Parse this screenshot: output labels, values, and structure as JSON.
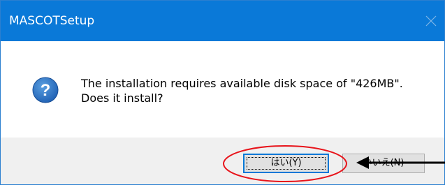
{
  "window": {
    "title": "MASCOTSetup",
    "close_icon": "close-icon"
  },
  "message": {
    "icon": "question-icon",
    "line1": "The installation requires available disk space of \"426MB\".",
    "line2": "Does it install?"
  },
  "buttons": {
    "yes_label": "はい(Y)",
    "no_label": "いいえ(N)"
  },
  "annotations": {
    "circle_color": "#e8141b",
    "arrow_color": "#000000"
  },
  "colors": {
    "titlebar": "#0a79d8",
    "accent": "#0078d7"
  }
}
